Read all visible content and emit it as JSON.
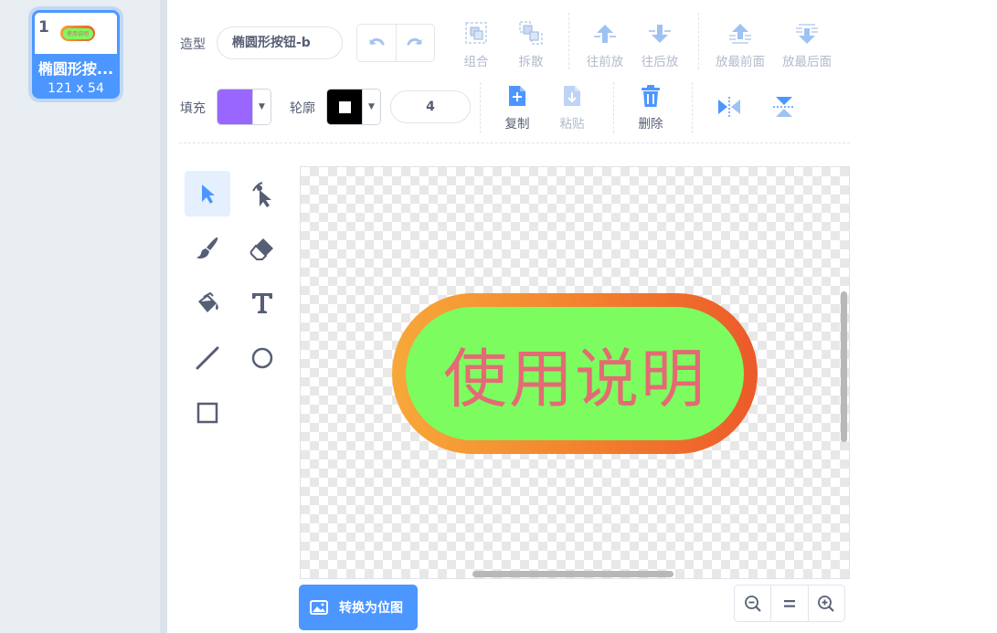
{
  "costume_list": {
    "items": [
      {
        "number": "1",
        "name": "椭圆形按...",
        "size": "121 x 54",
        "thumb_text": "使用说明",
        "selected": true
      }
    ]
  },
  "toolbar": {
    "costume_label": "造型",
    "costume_name": "椭圆形按钮-b",
    "undo_icon": "undo-icon",
    "redo_icon": "redo-icon",
    "group_label": "组合",
    "ungroup_label": "拆散",
    "forward_label": "往前放",
    "backward_label": "往后放",
    "front_label": "放最前面",
    "back_label": "放最后面",
    "fill_label": "填充",
    "fill_color": "#9966ff",
    "outline_label": "轮廓",
    "outline_color": "#000000",
    "outline_width": "4",
    "copy_label": "复制",
    "paste_label": "粘贴",
    "delete_label": "删除"
  },
  "tools": [
    "select",
    "reshape",
    "brush",
    "eraser",
    "fill",
    "text",
    "line",
    "circle",
    "rectangle"
  ],
  "canvas": {
    "button_text": "使用说明",
    "button_fill": "#7cfc5f",
    "button_text_color": "#e46a74",
    "outline_gradient": [
      "#f7a83a",
      "#ec5a2a"
    ]
  },
  "footer": {
    "convert_label": "转换为位图",
    "zoom_out_icon": "zoom-out-icon",
    "zoom_reset_icon": "zoom-reset-icon",
    "zoom_in_icon": "zoom-in-icon"
  }
}
